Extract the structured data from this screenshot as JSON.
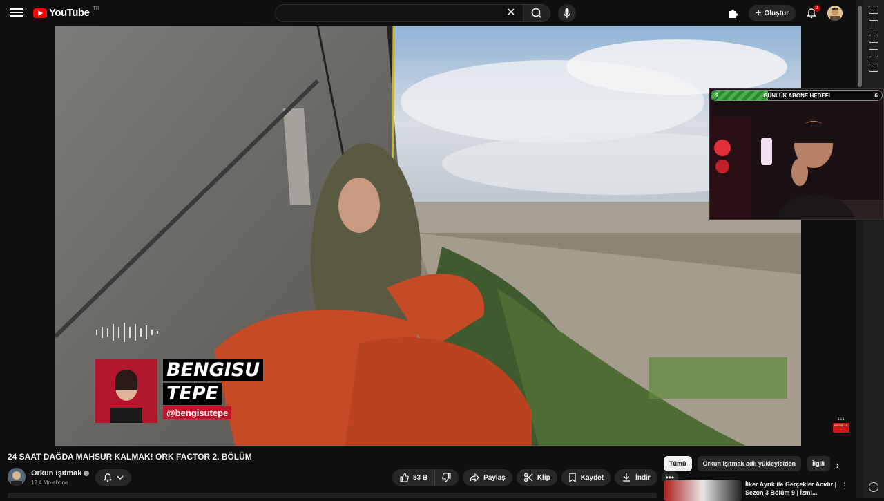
{
  "header": {
    "logo_text": "YouTube",
    "logo_country": "TR",
    "search": {
      "value": "",
      "placeholder": ""
    },
    "create_label": "Oluştur",
    "notification_count": "1"
  },
  "webcam": {
    "goal_left": "2",
    "goal_title": "GÜNLÜK ABONE HEDEFİ",
    "goal_right": "6",
    "goal_progress": 0.33
  },
  "video_overlay": {
    "name_line1": "BENGISU",
    "name_line2": "TEPE",
    "handle": "@bengisutepe",
    "abone_badge": "ABONE OL"
  },
  "video": {
    "title": "24 SAAT DAĞDA MAHSUR KALMAK! ORK FACTOR 2. BÖLÜM",
    "channel": "Orkun Işıtmak",
    "subscribers": "12,4 Mn abone"
  },
  "actions": {
    "likes": "83 B",
    "share": "Paylaş",
    "clip": "Klip",
    "save": "Kaydet",
    "download": "İndir"
  },
  "chips": [
    "Tümü",
    "Orkun Işıtmak adlı yükleyiciden",
    "İlgili"
  ],
  "recommendation": {
    "title": "İlker Ayrık ile Gerçekler Acıdır | Sezon 3 Bölüm 9 | İzmi..."
  },
  "colors": {
    "brand_red": "#ff0000",
    "accent_red": "#c4122a",
    "goal_green": "#49b049"
  }
}
